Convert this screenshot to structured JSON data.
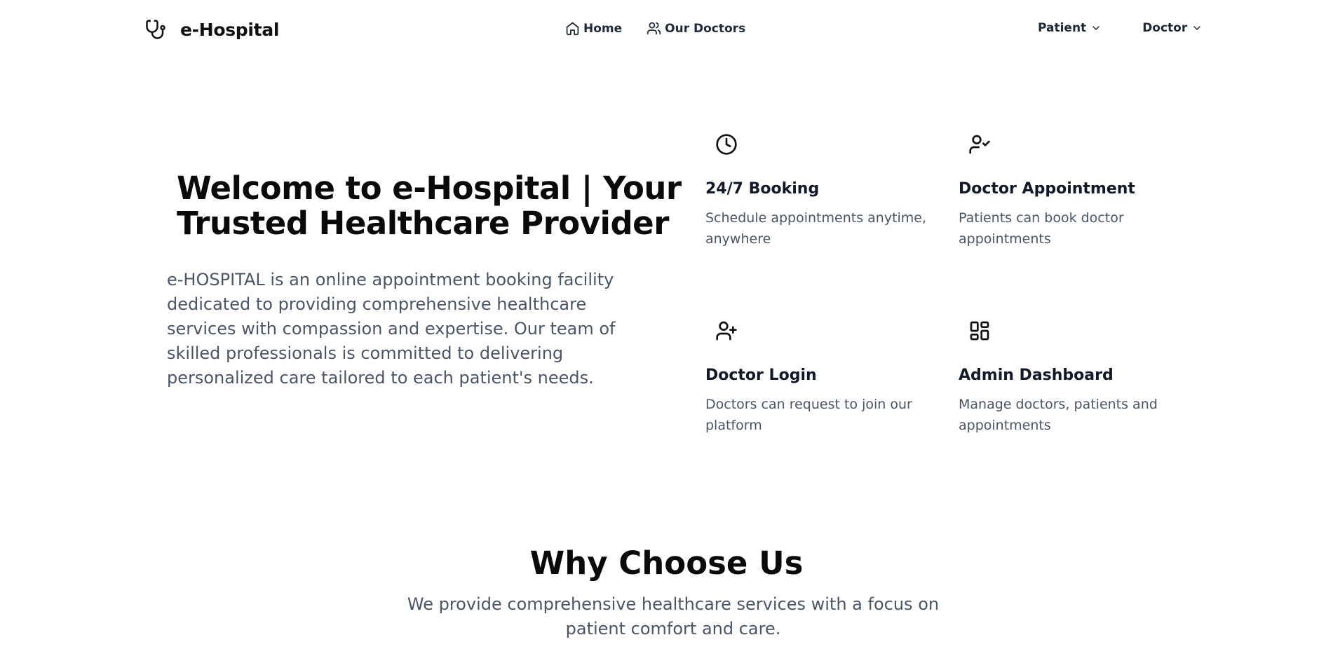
{
  "header": {
    "brand": {
      "name": "e-Hospital",
      "icon": "stethoscope-icon"
    },
    "nav": [
      {
        "label": "Home",
        "icon": "home-icon"
      },
      {
        "label": "Our Doctors",
        "icon": "users-icon"
      }
    ],
    "dropdowns": [
      {
        "label": "Patient",
        "icon": "chevron-down-icon"
      },
      {
        "label": "Doctor",
        "icon": "chevron-down-icon"
      }
    ]
  },
  "hero": {
    "title": "Welcome to e-Hospital | Your Trusted Healthcare Provider",
    "description": "e-HOSPITAL is an online appointment booking facility dedicated to providing comprehensive healthcare services with compassion and expertise. Our team of skilled professionals is committed to delivering personalized care tailored to each patient's needs."
  },
  "features": [
    {
      "icon": "clock-icon",
      "title": "24/7 Booking",
      "description": "Schedule appointments anytime, anywhere"
    },
    {
      "icon": "user-check-icon",
      "title": "Doctor Appointment",
      "description": "Patients can book doctor appointments"
    },
    {
      "icon": "user-plus-icon",
      "title": "Doctor Login",
      "description": "Doctors can request to join our platform"
    },
    {
      "icon": "dashboard-icon",
      "title": "Admin Dashboard",
      "description": "Manage doctors, patients and appointments"
    }
  ],
  "why": {
    "title": "Why Choose Us",
    "subtitle": "We provide comprehensive healthcare services with a focus on patient comfort and care."
  }
}
